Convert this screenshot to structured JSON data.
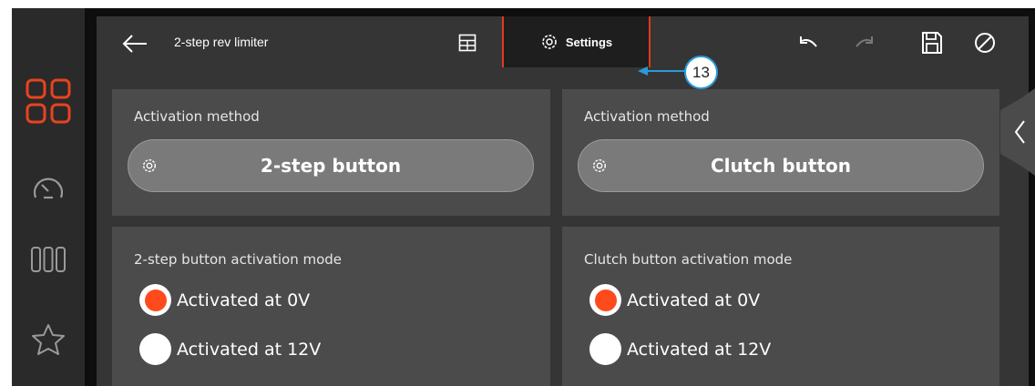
{
  "header": {
    "back_icon": "arrow-left-icon",
    "title": "2-step rev limiter",
    "table_icon": "table-grid-icon",
    "settings_tab": {
      "icon": "gear-icon",
      "label": "Settings",
      "active": true
    },
    "actions": [
      "undo-icon",
      "redo-icon",
      "save-icon",
      "cancel-icon"
    ]
  },
  "sidebar": {
    "items": [
      {
        "icon": "apps-grid-icon",
        "active": true
      },
      {
        "icon": "gauge-icon",
        "active": false
      },
      {
        "icon": "columns-icon",
        "active": false
      },
      {
        "icon": "star-icon",
        "active": false
      }
    ]
  },
  "panels": {
    "left_activation": {
      "title": "Activation method",
      "button_label": "2-step button"
    },
    "right_activation": {
      "title": "Activation method",
      "button_label": "Clutch button"
    },
    "left_mode": {
      "title": "2-step button activation mode",
      "options": [
        {
          "label": "Activated at 0V",
          "selected": true
        },
        {
          "label": "Activated at 12V",
          "selected": false
        }
      ]
    },
    "right_mode": {
      "title": "Clutch button activation mode",
      "options": [
        {
          "label": "Activated at 0V",
          "selected": true
        },
        {
          "label": "Activated at 12V",
          "selected": false
        }
      ]
    }
  },
  "callout": {
    "number": "13"
  },
  "colors": {
    "accent": "#ff4a1c",
    "callout": "#2b9ad8",
    "panel": "#4b4b4b"
  }
}
